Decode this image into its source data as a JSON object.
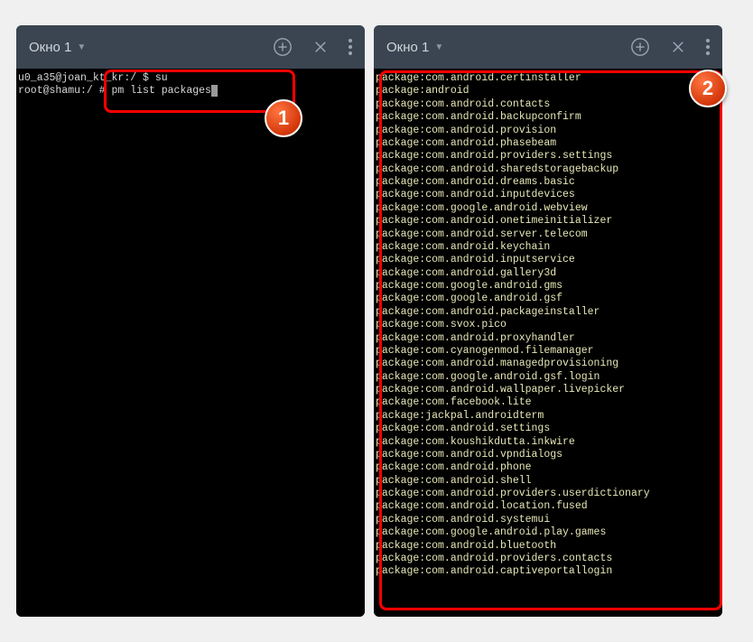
{
  "window1": {
    "title": "Окно 1",
    "prompt_line1": "u0_a35@joan_kt_kr:/ $ su",
    "prompt_line2_prefix": "root@shamu:/ # ",
    "command": "pm list packages"
  },
  "window2": {
    "title": "Окно 1",
    "packages": [
      "package:com.android.certinstaller",
      "package:android",
      "package:com.android.contacts",
      "package:com.android.backupconfirm",
      "package:com.android.provision",
      "package:com.android.phasebeam",
      "package:com.android.providers.settings",
      "package:com.android.sharedstoragebackup",
      "package:com.android.dreams.basic",
      "package:com.android.inputdevices",
      "package:com.google.android.webview",
      "package:com.android.onetimeinitializer",
      "package:com.android.server.telecom",
      "package:com.android.keychain",
      "package:com.android.inputservice",
      "package:com.android.gallery3d",
      "package:com.google.android.gms",
      "package:com.google.android.gsf",
      "package:com.android.packageinstaller",
      "package:com.svox.pico",
      "package:com.android.proxyhandler",
      "package:com.cyanogenmod.filemanager",
      "package:com.android.managedprovisioning",
      "package:com.google.android.gsf.login",
      "package:com.android.wallpaper.livepicker",
      "package:com.facebook.lite",
      "package:jackpal.androidterm",
      "package:com.android.settings",
      "package:com.koushikdutta.inkwire",
      "package:com.android.vpndialogs",
      "package:com.android.phone",
      "package:com.android.shell",
      "package:com.android.providers.userdictionary",
      "package:com.android.location.fused",
      "package:com.android.systemui",
      "package:com.google.android.play.games",
      "package:com.android.bluetooth",
      "package:com.android.providers.contacts",
      "package:com.android.captiveportallogin"
    ]
  },
  "badges": {
    "one": "1",
    "two": "2"
  }
}
